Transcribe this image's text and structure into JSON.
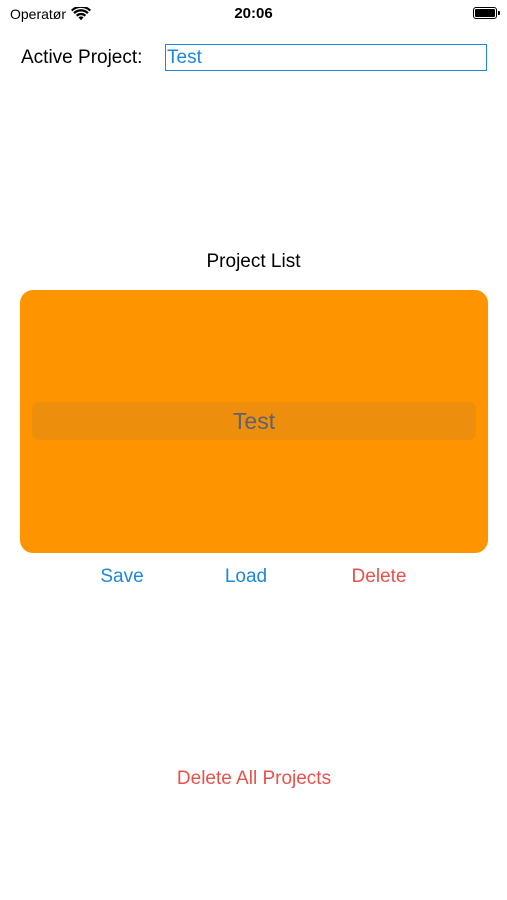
{
  "status_bar": {
    "carrier": "Operatør",
    "time": "20:06",
    "wifi_icon": "wifi-icon",
    "battery_icon": "battery-icon"
  },
  "active_project": {
    "label": "Active Project:",
    "value": "Test"
  },
  "project_list": {
    "title": "Project List",
    "items": [
      "Test"
    ],
    "selected": "Test",
    "background_color": "#fe9500"
  },
  "actions": {
    "save": "Save",
    "load": "Load",
    "delete": "Delete",
    "delete_all": "Delete All Projects"
  },
  "colors": {
    "accent_blue": "#1e87d9",
    "destructive_red": "#e5534b",
    "picker_orange": "#fe9500"
  }
}
